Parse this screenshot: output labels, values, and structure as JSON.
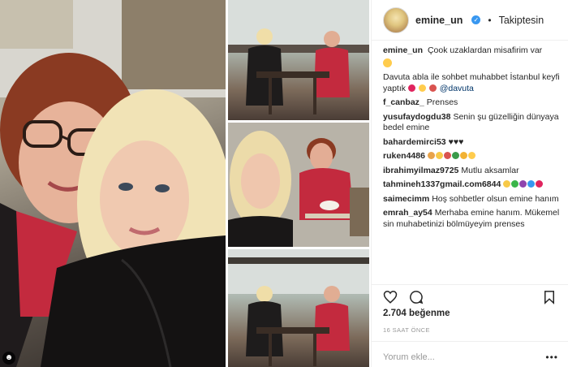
{
  "post_header": {
    "username": "emine_un",
    "separator": "•",
    "follow_status": "Takiptesin"
  },
  "caption": {
    "username": "emine_un",
    "text_line1": "Çook uzaklardan misafirim var",
    "text_line2": "Davuta abla ile sohbet muhabbet İstanbul keyfi yaptık",
    "mention": "@davuta"
  },
  "comments": [
    {
      "username": "f_canbaz_",
      "text": "Prenses",
      "emoji_colors": []
    },
    {
      "username": "yusufaydogdu38",
      "text": "Senin şu güzelliğin dünyaya bedel emine",
      "emoji_colors": []
    },
    {
      "username": "bahardemirci53",
      "text": "♥♥♥",
      "emoji_colors": []
    },
    {
      "username": "ruken4486",
      "text": "",
      "emoji_colors": [
        "#e8a34a",
        "#f7c948",
        "#d9534f",
        "#3a9a4a",
        "#f2b233",
        "#ffcc4d"
      ]
    },
    {
      "username": "ibrahimyilmaz9725",
      "text": "Mutlu aksamlar",
      "emoji_colors": []
    },
    {
      "username": "tahmineh1337gmail.com6844",
      "text": "",
      "emoji_colors": [
        "#f7c948",
        "#3bb54a",
        "#8e44ad",
        "#3897f0",
        "#e0245e"
      ]
    },
    {
      "username": "saimecimm",
      "text": "Hoş sohbetler olsun emine hanım",
      "emoji_colors": []
    },
    {
      "username": "emrah_ay54",
      "text": "Merhaba emine hanım. Mükemel sin muhabetinizi bölmüyeyim prenses",
      "emoji_colors": []
    }
  ],
  "likes": "2.704 beğenme",
  "time_ago": "16 SAAT ÖNCE",
  "add_comment": {
    "placeholder": "Yorum ekle..."
  },
  "icons": {
    "like": "heart-icon",
    "comment": "comment-bubble-icon",
    "save": "bookmark-icon",
    "more": "more-options-icon",
    "verified": "verified-badge-icon",
    "collage_corner": "tagged-users-icon"
  },
  "colors": {
    "verified_blue": "#3897f0",
    "mention_blue": "#003569",
    "border": "#efefef",
    "muted_text": "#999999"
  }
}
